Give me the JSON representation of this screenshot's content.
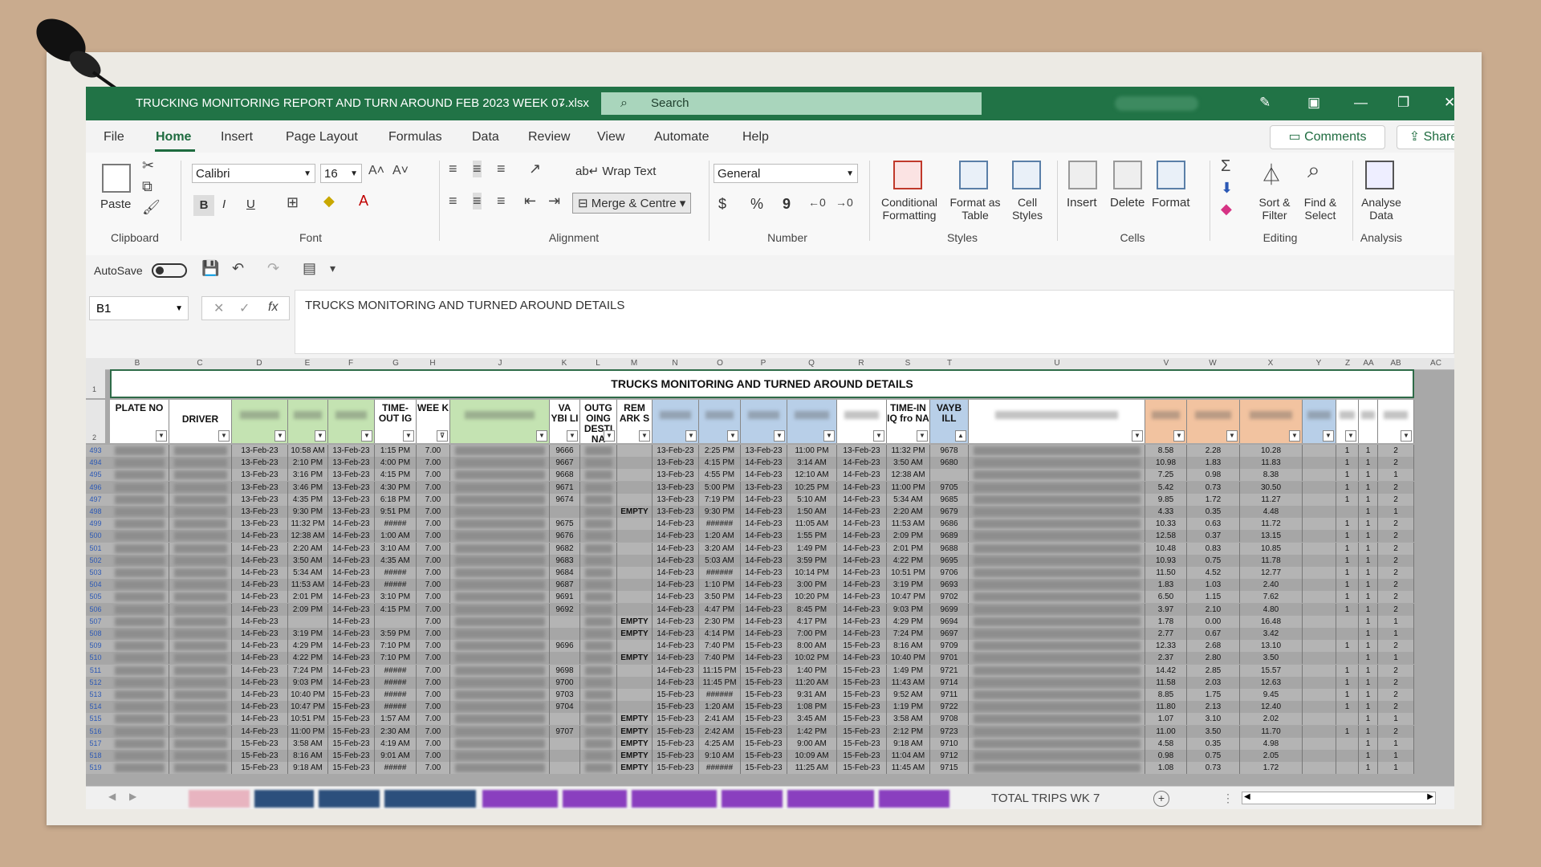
{
  "window": {
    "title": "TRUCKING MONITORING REPORT AND TURN AROUND FEB 2023 WEEK 07.xlsx",
    "search_placeholder": "Search"
  },
  "menu": [
    "File",
    "Home",
    "Insert",
    "Page Layout",
    "Formulas",
    "Data",
    "Review",
    "View",
    "Automate",
    "Help"
  ],
  "active_menu": "Home",
  "comments_label": "Comments",
  "share_label": "Share",
  "ribbon": {
    "clipboard": {
      "group": "Clipboard",
      "paste": "Paste"
    },
    "font": {
      "group": "Font",
      "name": "Calibri",
      "size": "16",
      "bold": "B",
      "italic": "I",
      "underline": "U"
    },
    "alignment": {
      "group": "Alignment",
      "wrap": "Wrap Text",
      "merge": "Merge & Centre"
    },
    "number": {
      "group": "Number",
      "format": "General",
      "currency": "$",
      "percent": "%",
      "comma": "9"
    },
    "styles": {
      "group": "Styles",
      "conditional": "Conditional Formatting",
      "format_table": "Format as Table",
      "cell_styles": "Cell Styles"
    },
    "cells": {
      "group": "Cells",
      "insert": "Insert",
      "delete": "Delete",
      "format": "Format"
    },
    "editing": {
      "group": "Editing",
      "sort": "Sort & Filter",
      "find": "Find & Select"
    },
    "analysis": {
      "group": "Analysis",
      "analyse": "Analyse Data"
    }
  },
  "qat": {
    "autosave": "AutoSave"
  },
  "formula_bar": {
    "cell": "B1",
    "fx": "fx",
    "content": "TRUCKS MONITORING  AND  TURNED AROUND DETAILS"
  },
  "sheet": {
    "title": "TRUCKS MONITORING  AND  TURNED AROUND DETAILS",
    "col_letters": [
      "B",
      "C",
      "D",
      "E",
      "F",
      "G",
      "H",
      "J",
      "K",
      "L",
      "M",
      "N",
      "O",
      "P",
      "Q",
      "R",
      "S",
      "T",
      "U",
      "V",
      "W",
      "X",
      "Y",
      "Z",
      "AA",
      "AB",
      "AC"
    ],
    "headers": {
      "plate": "PLATE NO",
      "driver": "DRIVER",
      "timeout": "TIME-OUT IG",
      "week": "WEE K",
      "waybill1": "VA YBI LI",
      "outgoing": "OUTG OING DESTI NA",
      "remark": "REM ARK S",
      "timein": "TIME-IN IQ fro NA",
      "waybill2": "VAYB ILL"
    },
    "rows": [
      {
        "n": "493",
        "d": "13-Feb-23",
        "e": "10:58 AM",
        "f": "13-Feb-23",
        "g": "1:15 PM",
        "h": "7.00",
        "k": "9666",
        "m": "",
        "n2": "13-Feb-23",
        "o": "2:25 PM",
        "p": "13-Feb-23",
        "q": "11:00 PM",
        "r": "13-Feb-23",
        "s": "11:32 PM",
        "t": "9678",
        "v": "8.58",
        "w": "2.28",
        "x": "10.28",
        "z": "1",
        "aa": "1",
        "ab": "2"
      },
      {
        "n": "494",
        "d": "13-Feb-23",
        "e": "2:10 PM",
        "f": "13-Feb-23",
        "g": "4:00 PM",
        "h": "7.00",
        "k": "9667",
        "m": "",
        "n2": "13-Feb-23",
        "o": "4:15 PM",
        "p": "14-Feb-23",
        "q": "3:14 AM",
        "r": "14-Feb-23",
        "s": "3:50 AM",
        "t": "9680",
        "v": "10.98",
        "w": "1.83",
        "x": "11.83",
        "z": "1",
        "aa": "1",
        "ab": "2"
      },
      {
        "n": "495",
        "d": "13-Feb-23",
        "e": "3:16 PM",
        "f": "13-Feb-23",
        "g": "4:15 PM",
        "h": "7.00",
        "k": "9668",
        "m": "",
        "n2": "13-Feb-23",
        "o": "4:55 PM",
        "p": "14-Feb-23",
        "q": "12:10 AM",
        "r": "14-Feb-23",
        "s": "12:38 AM",
        "t": "",
        "v": "7.25",
        "w": "0.98",
        "x": "8.38",
        "z": "1",
        "aa": "1",
        "ab": "1"
      },
      {
        "n": "496",
        "d": "13-Feb-23",
        "e": "3:46 PM",
        "f": "13-Feb-23",
        "g": "4:30 PM",
        "h": "7.00",
        "k": "9671",
        "m": "",
        "n2": "13-Feb-23",
        "o": "5:00 PM",
        "p": "13-Feb-23",
        "q": "10:25 PM",
        "r": "14-Feb-23",
        "s": "11:00 PM",
        "t": "9705",
        "v": "5.42",
        "w": "0.73",
        "x": "30.50",
        "z": "1",
        "aa": "1",
        "ab": "2"
      },
      {
        "n": "497",
        "d": "13-Feb-23",
        "e": "4:35 PM",
        "f": "13-Feb-23",
        "g": "6:18 PM",
        "h": "7.00",
        "k": "9674",
        "m": "",
        "n2": "13-Feb-23",
        "o": "7:19 PM",
        "p": "14-Feb-23",
        "q": "5:10 AM",
        "r": "14-Feb-23",
        "s": "5:34 AM",
        "t": "9685",
        "v": "9.85",
        "w": "1.72",
        "x": "11.27",
        "z": "1",
        "aa": "1",
        "ab": "2"
      },
      {
        "n": "498",
        "d": "13-Feb-23",
        "e": "9:30 PM",
        "f": "13-Feb-23",
        "g": "9:51 PM",
        "h": "7.00",
        "k": "",
        "m": "EMPTY",
        "n2": "13-Feb-23",
        "o": "9:30 PM",
        "p": "14-Feb-23",
        "q": "1:50 AM",
        "r": "14-Feb-23",
        "s": "2:20 AM",
        "t": "9679",
        "v": "4.33",
        "w": "0.35",
        "x": "4.48",
        "z": "",
        "aa": "1",
        "ab": "1"
      },
      {
        "n": "499",
        "d": "13-Feb-23",
        "e": "11:32 PM",
        "f": "14-Feb-23",
        "g": "#####",
        "h": "7.00",
        "k": "9675",
        "m": "",
        "n2": "14-Feb-23",
        "o": "######",
        "p": "14-Feb-23",
        "q": "11:05 AM",
        "r": "14-Feb-23",
        "s": "11:53 AM",
        "t": "9686",
        "v": "10.33",
        "w": "0.63",
        "x": "11.72",
        "z": "1",
        "aa": "1",
        "ab": "2"
      },
      {
        "n": "500",
        "d": "14-Feb-23",
        "e": "12:38 AM",
        "f": "14-Feb-23",
        "g": "1:00 AM",
        "h": "7.00",
        "k": "9676",
        "m": "",
        "n2": "14-Feb-23",
        "o": "1:20 AM",
        "p": "14-Feb-23",
        "q": "1:55 PM",
        "r": "14-Feb-23",
        "s": "2:09 PM",
        "t": "9689",
        "v": "12.58",
        "w": "0.37",
        "x": "13.15",
        "z": "1",
        "aa": "1",
        "ab": "2"
      },
      {
        "n": "501",
        "d": "14-Feb-23",
        "e": "2:20 AM",
        "f": "14-Feb-23",
        "g": "3:10 AM",
        "h": "7.00",
        "k": "9682",
        "m": "",
        "n2": "14-Feb-23",
        "o": "3:20 AM",
        "p": "14-Feb-23",
        "q": "1:49 PM",
        "r": "14-Feb-23",
        "s": "2:01 PM",
        "t": "9688",
        "v": "10.48",
        "w": "0.83",
        "x": "10.85",
        "z": "1",
        "aa": "1",
        "ab": "2"
      },
      {
        "n": "502",
        "d": "14-Feb-23",
        "e": "3:50 AM",
        "f": "14-Feb-23",
        "g": "4:35 AM",
        "h": "7.00",
        "k": "9683",
        "m": "",
        "n2": "14-Feb-23",
        "o": "5:03 AM",
        "p": "14-Feb-23",
        "q": "3:59 PM",
        "r": "14-Feb-23",
        "s": "4:22 PM",
        "t": "9695",
        "v": "10.93",
        "w": "0.75",
        "x": "11.78",
        "z": "1",
        "aa": "1",
        "ab": "2"
      },
      {
        "n": "503",
        "d": "14-Feb-23",
        "e": "5:34 AM",
        "f": "14-Feb-23",
        "g": "#####",
        "h": "7.00",
        "k": "9684",
        "m": "",
        "n2": "14-Feb-23",
        "o": "######",
        "p": "14-Feb-23",
        "q": "10:14 PM",
        "r": "14-Feb-23",
        "s": "10:51 PM",
        "t": "9706",
        "v": "11.50",
        "w": "4.52",
        "x": "12.77",
        "z": "1",
        "aa": "1",
        "ab": "2"
      },
      {
        "n": "504",
        "d": "14-Feb-23",
        "e": "11:53 AM",
        "f": "14-Feb-23",
        "g": "#####",
        "h": "7.00",
        "k": "9687",
        "m": "",
        "n2": "14-Feb-23",
        "o": "1:10 PM",
        "p": "14-Feb-23",
        "q": "3:00 PM",
        "r": "14-Feb-23",
        "s": "3:19 PM",
        "t": "9693",
        "v": "1.83",
        "w": "1.03",
        "x": "2.40",
        "z": "1",
        "aa": "1",
        "ab": "2"
      },
      {
        "n": "505",
        "d": "14-Feb-23",
        "e": "2:01 PM",
        "f": "14-Feb-23",
        "g": "3:10 PM",
        "h": "7.00",
        "k": "9691",
        "m": "",
        "n2": "14-Feb-23",
        "o": "3:50 PM",
        "p": "14-Feb-23",
        "q": "10:20 PM",
        "r": "14-Feb-23",
        "s": "10:47 PM",
        "t": "9702",
        "v": "6.50",
        "w": "1.15",
        "x": "7.62",
        "z": "1",
        "aa": "1",
        "ab": "2"
      },
      {
        "n": "506",
        "d": "14-Feb-23",
        "e": "2:09 PM",
        "f": "14-Feb-23",
        "g": "4:15 PM",
        "h": "7.00",
        "k": "9692",
        "m": "",
        "n2": "14-Feb-23",
        "o": "4:47 PM",
        "p": "14-Feb-23",
        "q": "8:45 PM",
        "r": "14-Feb-23",
        "s": "9:03 PM",
        "t": "9699",
        "v": "3.97",
        "w": "2.10",
        "x": "4.80",
        "z": "1",
        "aa": "1",
        "ab": "2"
      },
      {
        "n": "507",
        "d": "14-Feb-23",
        "e": "",
        "f": "14-Feb-23",
        "g": "",
        "h": "7.00",
        "k": "",
        "m": "EMPTY",
        "n2": "14-Feb-23",
        "o": "2:30 PM",
        "p": "14-Feb-23",
        "q": "4:17 PM",
        "r": "14-Feb-23",
        "s": "4:29 PM",
        "t": "9694",
        "v": "1.78",
        "w": "0.00",
        "x": "16.48",
        "z": "",
        "aa": "1",
        "ab": "1"
      },
      {
        "n": "508",
        "d": "14-Feb-23",
        "e": "3:19 PM",
        "f": "14-Feb-23",
        "g": "3:59 PM",
        "h": "7.00",
        "k": "",
        "m": "EMPTY",
        "n2": "14-Feb-23",
        "o": "4:14 PM",
        "p": "14-Feb-23",
        "q": "7:00 PM",
        "r": "14-Feb-23",
        "s": "7:24 PM",
        "t": "9697",
        "v": "2.77",
        "w": "0.67",
        "x": "3.42",
        "z": "",
        "aa": "1",
        "ab": "1"
      },
      {
        "n": "509",
        "d": "14-Feb-23",
        "e": "4:29 PM",
        "f": "14-Feb-23",
        "g": "7:10 PM",
        "h": "7.00",
        "k": "9696",
        "m": "",
        "n2": "14-Feb-23",
        "o": "7:40 PM",
        "p": "15-Feb-23",
        "q": "8:00 AM",
        "r": "15-Feb-23",
        "s": "8:16 AM",
        "t": "9709",
        "v": "12.33",
        "w": "2.68",
        "x": "13.10",
        "z": "1",
        "aa": "1",
        "ab": "2"
      },
      {
        "n": "510",
        "d": "14-Feb-23",
        "e": "4:22 PM",
        "f": "14-Feb-23",
        "g": "7:10 PM",
        "h": "7.00",
        "k": "",
        "m": "EMPTY",
        "n2": "14-Feb-23",
        "o": "7:40 PM",
        "p": "14-Feb-23",
        "q": "10:02 PM",
        "r": "14-Feb-23",
        "s": "10:40 PM",
        "t": "9701",
        "v": "2.37",
        "w": "2.80",
        "x": "3.50",
        "z": "",
        "aa": "1",
        "ab": "1"
      },
      {
        "n": "511",
        "d": "14-Feb-23",
        "e": "7:24 PM",
        "f": "14-Feb-23",
        "g": "#####",
        "h": "7.00",
        "k": "9698",
        "m": "",
        "n2": "14-Feb-23",
        "o": "11:15 PM",
        "p": "15-Feb-23",
        "q": "1:40 PM",
        "r": "15-Feb-23",
        "s": "1:49 PM",
        "t": "9721",
        "v": "14.42",
        "w": "2.85",
        "x": "15.57",
        "z": "1",
        "aa": "1",
        "ab": "2"
      },
      {
        "n": "512",
        "d": "14-Feb-23",
        "e": "9:03 PM",
        "f": "14-Feb-23",
        "g": "#####",
        "h": "7.00",
        "k": "9700",
        "m": "",
        "n2": "14-Feb-23",
        "o": "11:45 PM",
        "p": "15-Feb-23",
        "q": "11:20 AM",
        "r": "15-Feb-23",
        "s": "11:43 AM",
        "t": "9714",
        "v": "11.58",
        "w": "2.03",
        "x": "12.63",
        "z": "1",
        "aa": "1",
        "ab": "2"
      },
      {
        "n": "513",
        "d": "14-Feb-23",
        "e": "10:40 PM",
        "f": "15-Feb-23",
        "g": "#####",
        "h": "7.00",
        "k": "9703",
        "m": "",
        "n2": "15-Feb-23",
        "o": "######",
        "p": "15-Feb-23",
        "q": "9:31 AM",
        "r": "15-Feb-23",
        "s": "9:52 AM",
        "t": "9711",
        "v": "8.85",
        "w": "1.75",
        "x": "9.45",
        "z": "1",
        "aa": "1",
        "ab": "2"
      },
      {
        "n": "514",
        "d": "14-Feb-23",
        "e": "10:47 PM",
        "f": "15-Feb-23",
        "g": "#####",
        "h": "7.00",
        "k": "9704",
        "m": "",
        "n2": "15-Feb-23",
        "o": "1:20 AM",
        "p": "15-Feb-23",
        "q": "1:08 PM",
        "r": "15-Feb-23",
        "s": "1:19 PM",
        "t": "9722",
        "v": "11.80",
        "w": "2.13",
        "x": "12.40",
        "z": "1",
        "aa": "1",
        "ab": "2"
      },
      {
        "n": "515",
        "d": "14-Feb-23",
        "e": "10:51 PM",
        "f": "15-Feb-23",
        "g": "1:57 AM",
        "h": "7.00",
        "k": "",
        "m": "EMPTY",
        "n2": "15-Feb-23",
        "o": "2:41 AM",
        "p": "15-Feb-23",
        "q": "3:45 AM",
        "r": "15-Feb-23",
        "s": "3:58 AM",
        "t": "9708",
        "v": "1.07",
        "w": "3.10",
        "x": "2.02",
        "z": "",
        "aa": "1",
        "ab": "1"
      },
      {
        "n": "516",
        "d": "14-Feb-23",
        "e": "11:00 PM",
        "f": "15-Feb-23",
        "g": "2:30 AM",
        "h": "7.00",
        "k": "9707",
        "m": "EMPTY",
        "n2": "15-Feb-23",
        "o": "2:42 AM",
        "p": "15-Feb-23",
        "q": "1:42 PM",
        "r": "15-Feb-23",
        "s": "2:12 PM",
        "t": "9723",
        "v": "11.00",
        "w": "3.50",
        "x": "11.70",
        "z": "1",
        "aa": "1",
        "ab": "2"
      },
      {
        "n": "517",
        "d": "15-Feb-23",
        "e": "3:58 AM",
        "f": "15-Feb-23",
        "g": "4:19 AM",
        "h": "7.00",
        "k": "",
        "m": "EMPTY",
        "n2": "15-Feb-23",
        "o": "4:25 AM",
        "p": "15-Feb-23",
        "q": "9:00 AM",
        "r": "15-Feb-23",
        "s": "9:18 AM",
        "t": "9710",
        "v": "4.58",
        "w": "0.35",
        "x": "4.98",
        "z": "",
        "aa": "1",
        "ab": "1"
      },
      {
        "n": "518",
        "d": "15-Feb-23",
        "e": "8:16 AM",
        "f": "15-Feb-23",
        "g": "9:01 AM",
        "h": "7.00",
        "k": "",
        "m": "EMPTY",
        "n2": "15-Feb-23",
        "o": "9:10 AM",
        "p": "15-Feb-23",
        "q": "10:09 AM",
        "r": "15-Feb-23",
        "s": "11:04 AM",
        "t": "9712",
        "v": "0.98",
        "w": "0.75",
        "x": "2.05",
        "z": "",
        "aa": "1",
        "ab": "1"
      },
      {
        "n": "519",
        "d": "15-Feb-23",
        "e": "9:18 AM",
        "f": "15-Feb-23",
        "g": "#####",
        "h": "7.00",
        "k": "",
        "m": "EMPTY",
        "n2": "15-Feb-23",
        "o": "######",
        "p": "15-Feb-23",
        "q": "11:25 AM",
        "r": "15-Feb-23",
        "s": "11:45 AM",
        "t": "9715",
        "v": "1.08",
        "w": "0.73",
        "x": "1.72",
        "z": "",
        "aa": "1",
        "ab": "1"
      }
    ]
  },
  "sheet_tabs": {
    "total": "TOTAL TRIPS WK 7",
    "blurred_colors": [
      "#e8b4c0",
      "#2c4f7c",
      "#2c4f7c",
      "#2c4f7c",
      "#8a3fbf",
      "#8a3fbf",
      "#8a3fbf",
      "#8a3fbf",
      "#8a3fbf",
      "#8a3fbf"
    ]
  },
  "colors": {
    "excel_green": "#217346",
    "header_green": "#c4e3b2",
    "header_blue": "#b8cfe8",
    "header_orange": "#f2c3a0"
  }
}
